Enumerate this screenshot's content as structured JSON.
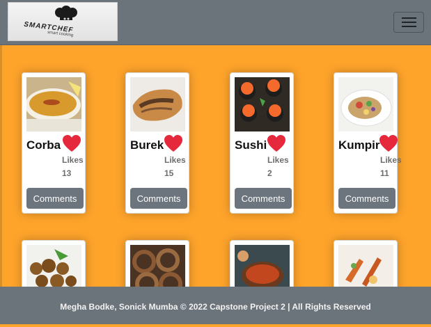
{
  "brand": {
    "logo_text": "SMARTCHEF",
    "logo_sub": "smart cooking"
  },
  "meals": [
    {
      "name": "Corba",
      "likes_label": "Likes",
      "likes": "13",
      "comments_label": "Comments"
    },
    {
      "name": "Burek",
      "likes_label": "Likes",
      "likes": "15",
      "comments_label": "Comments"
    },
    {
      "name": "Sushi",
      "likes_label": "Likes",
      "likes": "2",
      "comments_label": "Comments"
    },
    {
      "name": "Kumpir",
      "likes_label": "Likes",
      "likes": "11",
      "comments_label": "Comments"
    }
  ],
  "icons": {
    "menu": "hamburger-icon",
    "like": "heart-icon"
  },
  "colors": {
    "page_bg": "#fea42b",
    "navbar": "#6b737b",
    "button": "#6c757d",
    "heart": "#e5283c"
  },
  "footer": {
    "text": "Megha Bodke, Sonick Mumba © 2022 Capstone Project 2 | All Rights Reserved"
  }
}
